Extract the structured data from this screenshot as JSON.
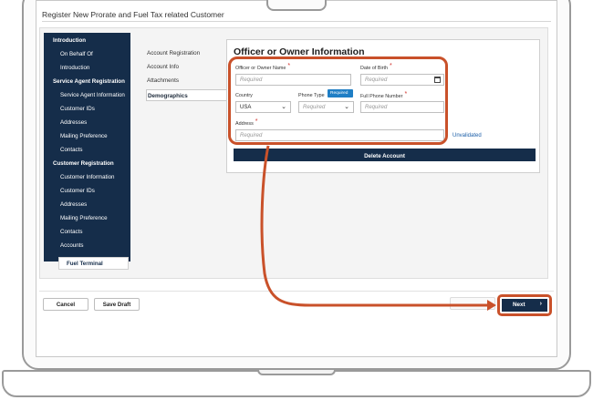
{
  "window": {
    "title": "Register New Prorate and Fuel Tax related Customer"
  },
  "nav": {
    "items": [
      {
        "label": "Introduction",
        "type": "section"
      },
      {
        "label": "On Behalf Of",
        "type": "sub"
      },
      {
        "label": "Introduction",
        "type": "sub"
      },
      {
        "label": "Service Agent Registration",
        "type": "section"
      },
      {
        "label": "Service Agent Information",
        "type": "sub"
      },
      {
        "label": "Customer IDs",
        "type": "sub"
      },
      {
        "label": "Addresses",
        "type": "sub"
      },
      {
        "label": "Mailing Preference",
        "type": "sub"
      },
      {
        "label": "Contacts",
        "type": "sub"
      },
      {
        "label": "Customer Registration",
        "type": "section"
      },
      {
        "label": "Customer Information",
        "type": "sub"
      },
      {
        "label": "Customer IDs",
        "type": "sub"
      },
      {
        "label": "Addresses",
        "type": "sub"
      },
      {
        "label": "Mailing Preference",
        "type": "sub"
      },
      {
        "label": "Contacts",
        "type": "sub"
      },
      {
        "label": "Accounts",
        "type": "sub"
      }
    ],
    "active": "Fuel Terminal"
  },
  "tabs": [
    {
      "label": "Account Registration"
    },
    {
      "label": "Account Info"
    },
    {
      "label": "Attachments"
    },
    {
      "label": "Demographics"
    }
  ],
  "form": {
    "heading": "Officer or Owner Information",
    "owner_name": {
      "label": "Officer or Owner Name",
      "placeholder": "Required"
    },
    "dob": {
      "label": "Date of Birth",
      "placeholder": "Required"
    },
    "country": {
      "label": "Country",
      "value": "USA"
    },
    "phone_type": {
      "label": "Phone Type",
      "placeholder": "Required",
      "tooltip": "Required"
    },
    "phone_number": {
      "label": "Full Phone Number",
      "placeholder": "Required"
    },
    "address": {
      "label": "Address",
      "placeholder": "Required"
    },
    "required_mark": "*",
    "address_status": "Unvalidated",
    "delete_label": "Delete Account"
  },
  "footer": {
    "cancel_label": "Cancel",
    "save_draft_label": "Save Draft",
    "next_label": "Next",
    "next_arrow": "›"
  },
  "colors": {
    "nav_bg": "#152d4a",
    "highlight": "#c9512a",
    "tooltip": "#1f7ec5",
    "link": "#1b5ea8"
  }
}
